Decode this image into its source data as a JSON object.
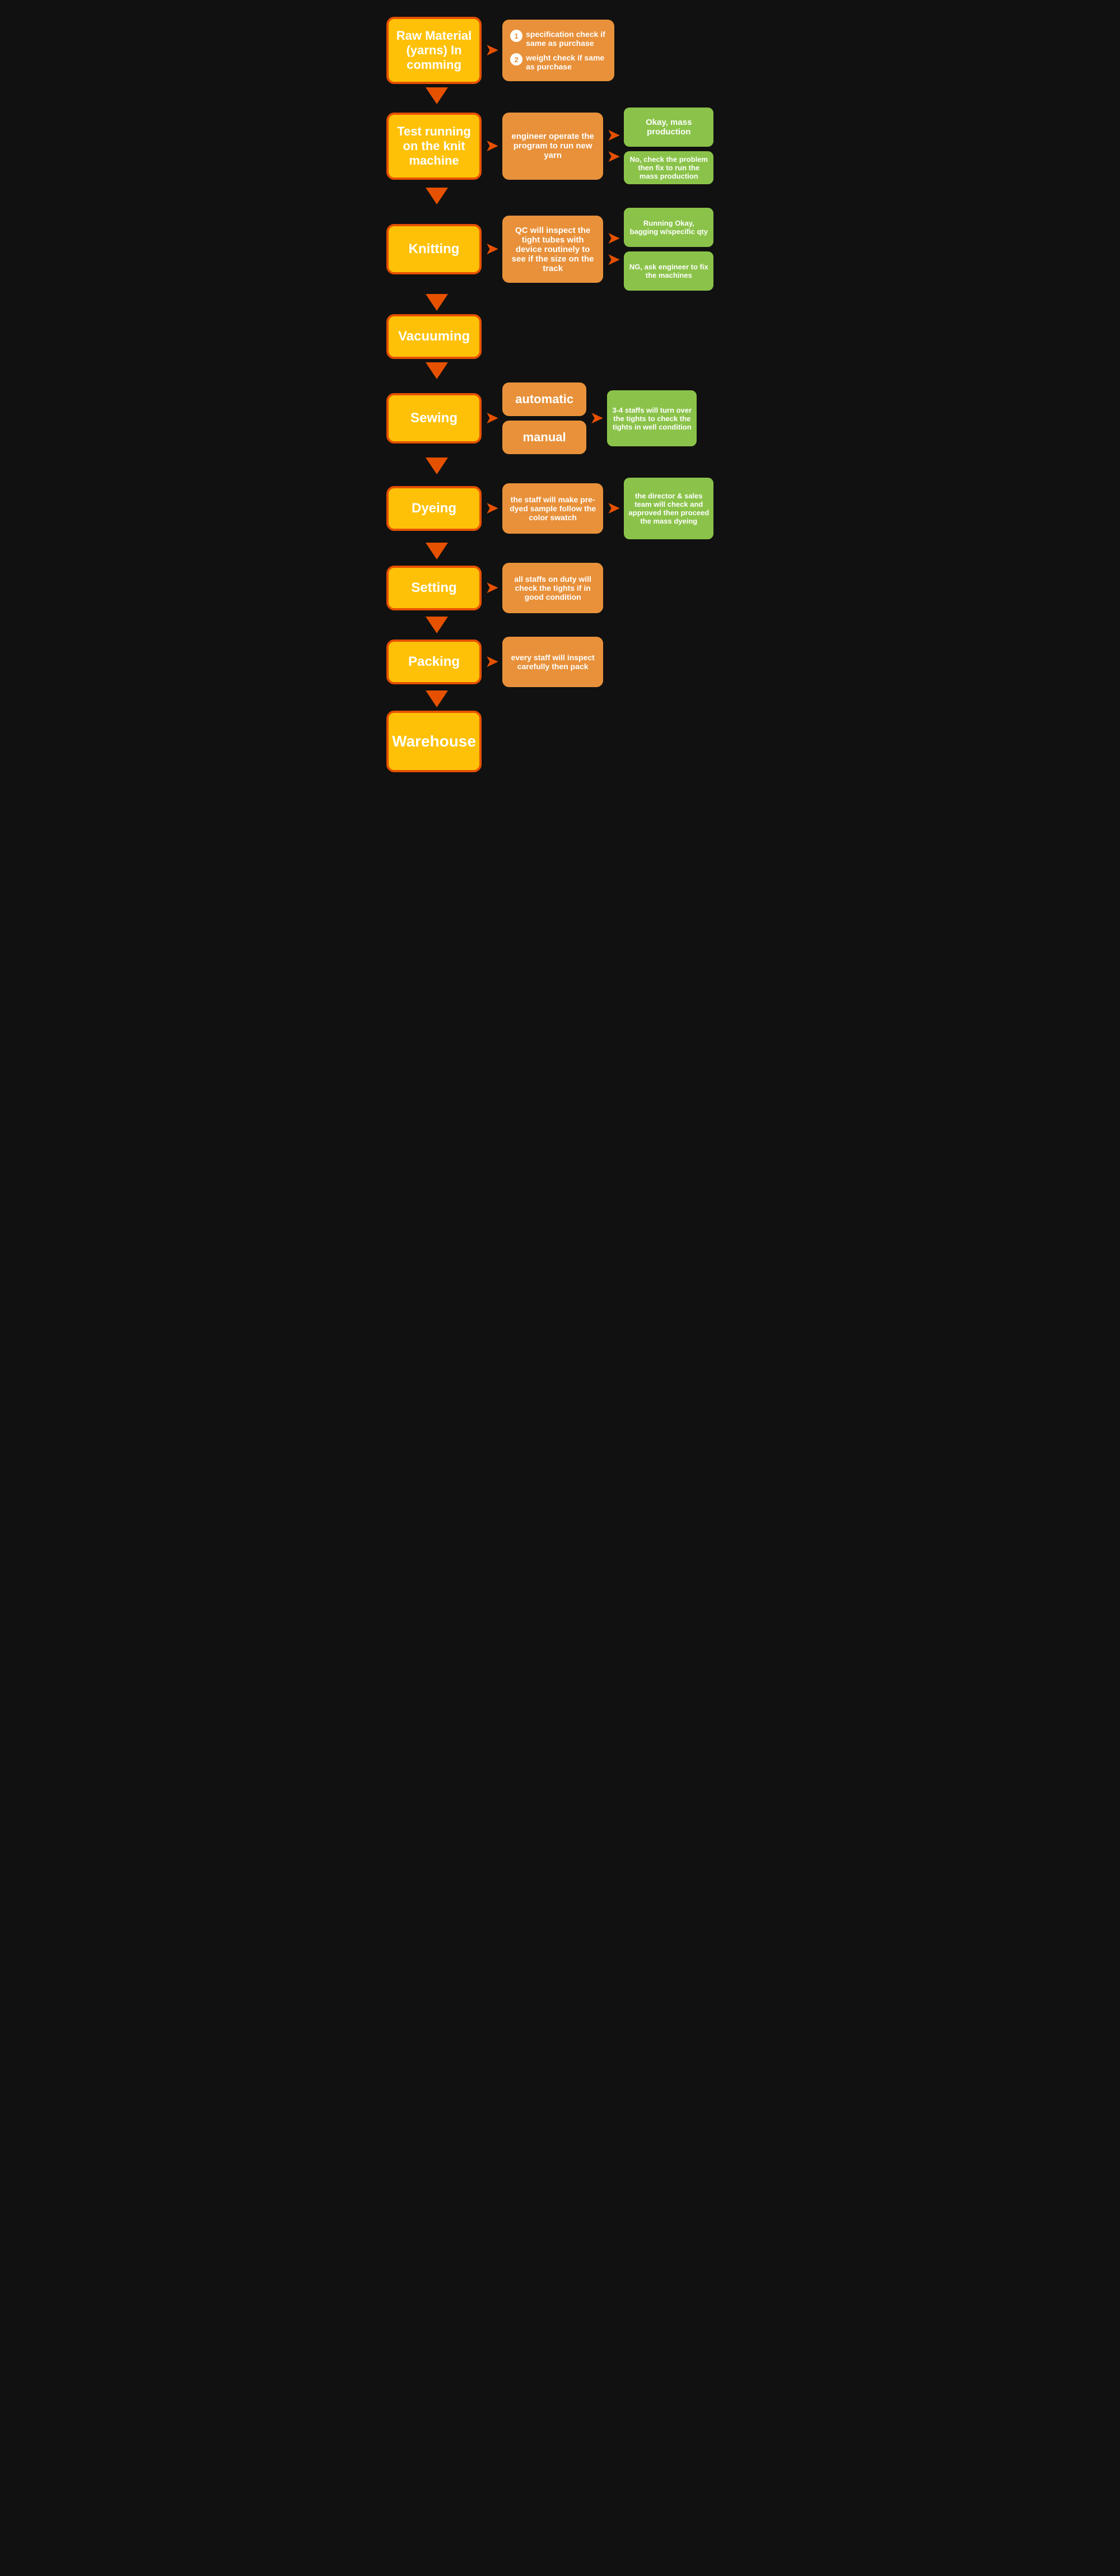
{
  "steps": [
    {
      "id": "raw-material",
      "main_label": "Raw Material (yarns) In comming",
      "description_type": "numbered",
      "description_items": [
        "specification check if same as purchase",
        "weight check if same as purchase"
      ],
      "results": []
    },
    {
      "id": "test-running",
      "main_label": "Test running on the knit machine",
      "description": "engineer operate the program to run new yarn",
      "results": [
        {
          "text": "Okay, mass production",
          "type": "green"
        },
        {
          "text": "No, check the problem then fix to run the mass production",
          "type": "green-sm"
        }
      ]
    },
    {
      "id": "knitting",
      "main_label": "Knitting",
      "description": "QC will inspect the tight tubes with device routinely to see if the size on the track",
      "results": [
        {
          "text": "Running Okay, bagging w/specific qty",
          "type": "green"
        },
        {
          "text": "NG, ask engineer to fix the machines",
          "type": "green"
        }
      ]
    },
    {
      "id": "vacuuming",
      "main_label": "Vacuuming",
      "description": "",
      "results": []
    },
    {
      "id": "sewing",
      "main_label": "Sewing",
      "description_type": "auto-manual",
      "auto_label": "automatic",
      "manual_label": "manual",
      "result": "3-4 staffs will turn over the tights to check the tights in well condition"
    },
    {
      "id": "dyeing",
      "main_label": "Dyeing",
      "description": "the staff will make pre-dyed sample follow the color swatch",
      "results": [
        {
          "text": "the director & sales team will check and approved then proceed the mass dyeing",
          "type": "green-sm"
        }
      ]
    },
    {
      "id": "setting",
      "main_label": "Setting",
      "description": "all staffs on duty will check the tights if in good condition",
      "results": []
    },
    {
      "id": "packing",
      "main_label": "Packing",
      "description": "every staff will inspect carefully then pack",
      "results": []
    },
    {
      "id": "warehouse",
      "main_label": "Warehouse",
      "description": "",
      "results": []
    }
  ],
  "arrow_char": "➤"
}
